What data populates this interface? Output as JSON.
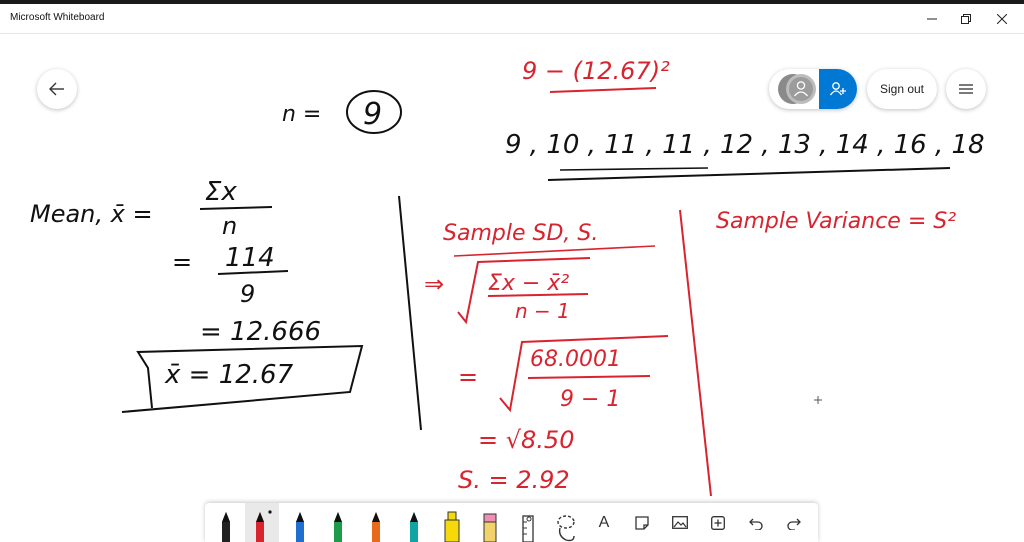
{
  "window": {
    "title": "Microsoft Whiteboard",
    "minimize_icon": "minimize-icon",
    "maximize_icon": "restore-icon",
    "close_icon": "close-icon"
  },
  "header": {
    "back_icon": "arrow-left-icon",
    "sign_out_label": "Sign out",
    "menu_icon": "hamburger-icon",
    "invite_icon": "add-person-icon",
    "accent_color": "#0078d4"
  },
  "board": {
    "ink_color_black": "#111111",
    "ink_color_red": "#d8242f",
    "left": {
      "n_label": "n =",
      "n_value": "9",
      "mean_label": "Mean, x̄ =",
      "mean_numerator": "Σx",
      "mean_denominator": "n",
      "step2_eq": "=",
      "step2_num": "114",
      "step2_den": "9",
      "step3": "= 12.666",
      "result": "x̄ = 12.67"
    },
    "top_right": {
      "formula": "9 − (12.67)²",
      "data_list": "9 , 10 , 11 , 11 , 12 , 13 , 14 , 16 , 18"
    },
    "middle": {
      "heading": "Sample SD, S.",
      "line1_prefix": "⇒",
      "line1_num": "Σx − x̄²",
      "line1_den": "n − 1",
      "line2_prefix": "=",
      "line2_num": "68.0001",
      "line2_den": "9 − 1",
      "line3": "= √8.50",
      "line4": "S. = 2.92"
    },
    "right": {
      "heading": "Sample Variance = S²"
    }
  },
  "toolbar": {
    "tools": [
      {
        "name": "pen-black",
        "color": "#111111"
      },
      {
        "name": "pen-red",
        "color": "#d8242f"
      },
      {
        "name": "pen-blue",
        "color": "#1f6fd1"
      },
      {
        "name": "pen-green",
        "color": "#1e9a4a"
      },
      {
        "name": "pen-orange",
        "color": "#e86a1a"
      },
      {
        "name": "pen-teal",
        "color": "#12a3a3"
      },
      {
        "name": "highlighter-yellow",
        "color": "#f5d90a"
      },
      {
        "name": "eraser",
        "color": "#f08fb3"
      },
      {
        "name": "ruler",
        "color": "#333333"
      },
      {
        "name": "lasso",
        "color": "#333333"
      },
      {
        "name": "text",
        "color": "#333333"
      },
      {
        "name": "note",
        "color": "#333333"
      },
      {
        "name": "image",
        "color": "#333333"
      },
      {
        "name": "add",
        "color": "#333333"
      },
      {
        "name": "undo",
        "color": "#333333"
      },
      {
        "name": "redo",
        "color": "#333333"
      }
    ],
    "text_tool_label": "A"
  }
}
